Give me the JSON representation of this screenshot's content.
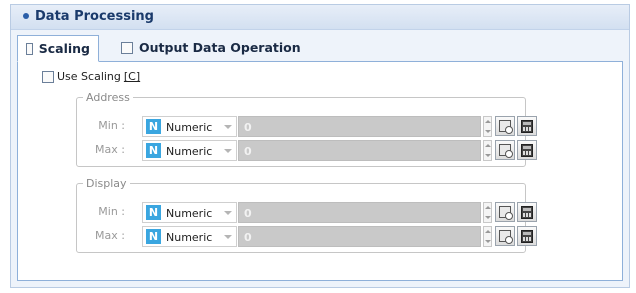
{
  "panel": {
    "title": "Data Processing"
  },
  "tabs": [
    {
      "label": "Scaling",
      "active": true
    },
    {
      "label": "Output Data Operation",
      "active": false
    }
  ],
  "use_scaling": {
    "label": "Use Scaling",
    "accel": "[C]",
    "checked": false
  },
  "groups": {
    "address": {
      "title": "Address",
      "rows": [
        {
          "label": "Min :",
          "type": "Numeric",
          "type_badge": "N",
          "value": "0"
        },
        {
          "label": "Max :",
          "type": "Numeric",
          "type_badge": "N",
          "value": "0"
        }
      ]
    },
    "display": {
      "title": "Display",
      "rows": [
        {
          "label": "Min :",
          "type": "Numeric",
          "type_badge": "N",
          "value": "0"
        },
        {
          "label": "Max :",
          "type": "Numeric",
          "type_badge": "N",
          "value": "0"
        }
      ]
    }
  },
  "icons": {
    "device_button": "device-icon",
    "calculator_button": "calculator-icon"
  },
  "colors": {
    "accent": "#2a5ea8",
    "badge": "#3aa6e0",
    "disabled_field": "#c9c9c9"
  }
}
